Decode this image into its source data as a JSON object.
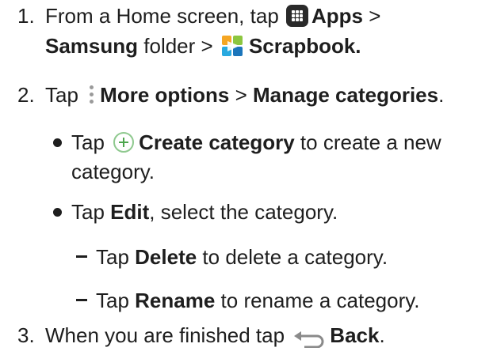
{
  "steps": [
    {
      "number": "1.",
      "line1": {
        "pre": "From a Home screen, tap ",
        "icon": "apps-grid-icon",
        "apps": "Apps",
        "gt": " >"
      },
      "line2": {
        "samsung": "Samsung",
        "folder": " folder > ",
        "icon": "scrapbook-app-icon",
        "scrapbook": "Scrapbook."
      }
    },
    {
      "number": "2.",
      "pre": "Tap ",
      "icon": "more-options-icon",
      "more_options": "More options",
      "gt": " > ",
      "manage": "Manage categories",
      "end": "."
    },
    {
      "number": "3.",
      "pre": "When you are finished tap ",
      "icon": "back-arrow-icon",
      "back": "Back",
      "end": "."
    }
  ],
  "bullets": [
    {
      "pre": "Tap ",
      "icon": "add-circle-icon",
      "bold": "Create category",
      "post": " to create a new",
      "line2": "category."
    },
    {
      "pre": "Tap ",
      "bold": "Edit",
      "post": ", select the category."
    }
  ],
  "dashes": [
    {
      "pre": "Tap ",
      "bold": "Delete",
      "post": " to delete a category."
    },
    {
      "pre": "Tap ",
      "bold": "Rename",
      "post": " to rename a category."
    }
  ],
  "colors": {
    "text": "#1e1e1e",
    "plus_green": "#4ea64e",
    "more_dots": "#9a9a9a"
  }
}
